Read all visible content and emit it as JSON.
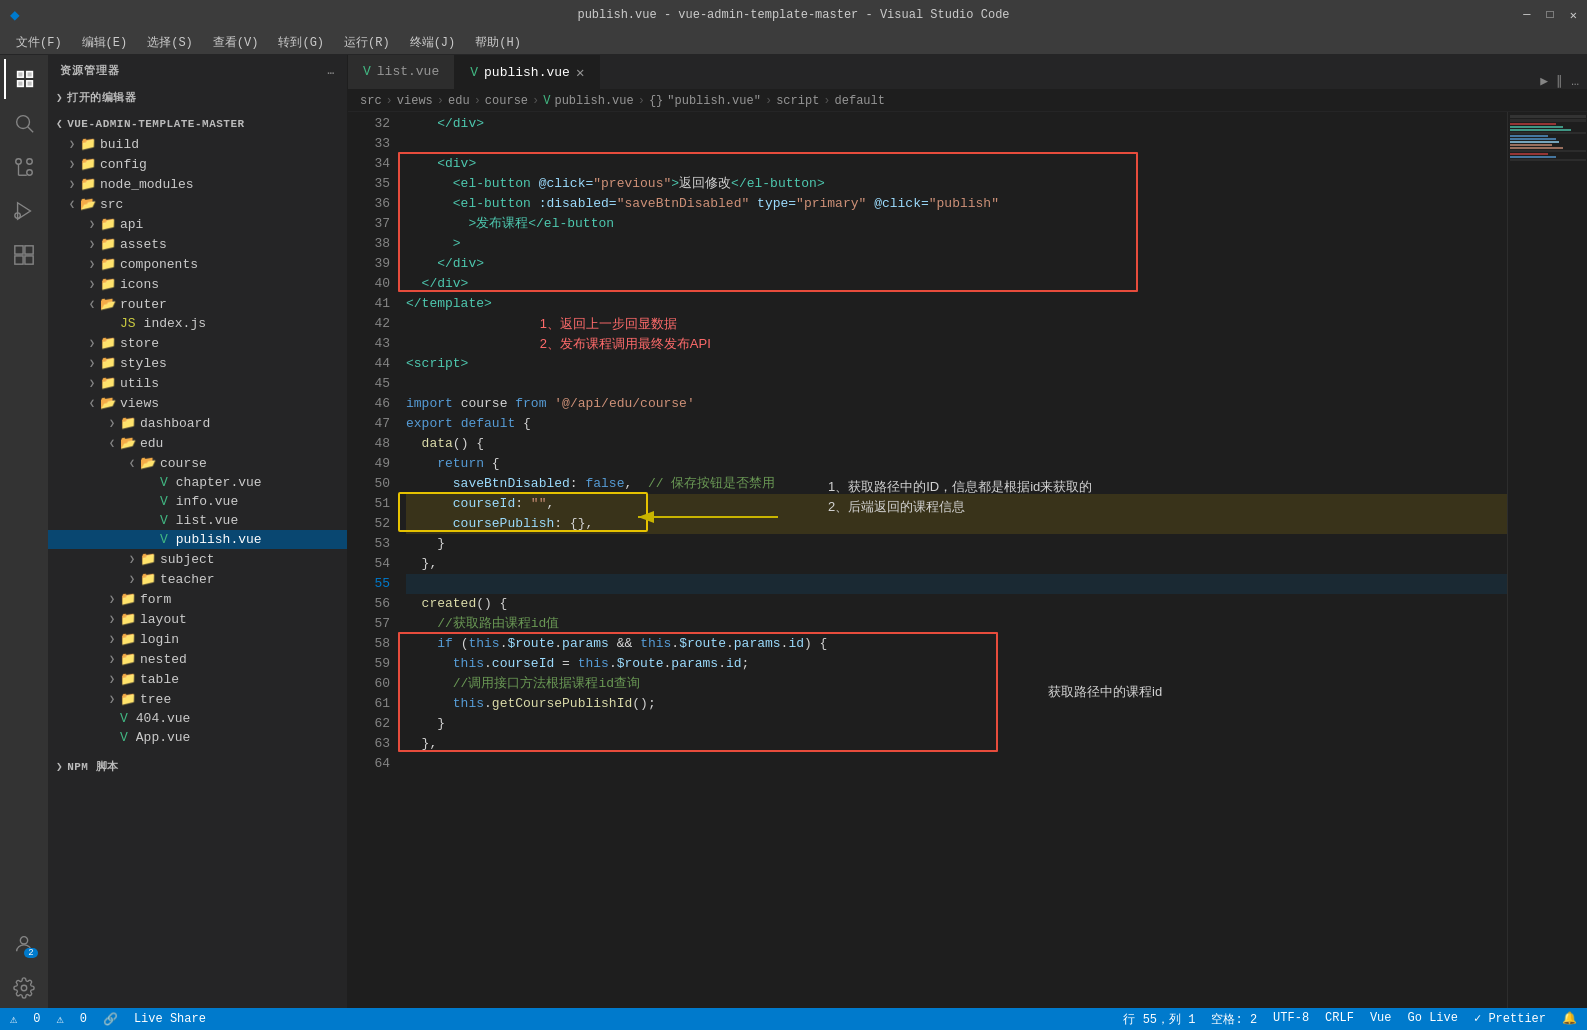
{
  "titleBar": {
    "title": "publish.vue - vue-admin-template-master - Visual Studio Code",
    "menuItems": [
      "文件(F)",
      "编辑(E)",
      "选择(S)",
      "查看(V)",
      "转到(G)",
      "运行(R)",
      "终端(J)",
      "帮助(H)"
    ]
  },
  "tabs": [
    {
      "id": "list",
      "label": "list.vue",
      "active": false,
      "icon": "vue"
    },
    {
      "id": "publish",
      "label": "publish.vue",
      "active": true,
      "icon": "vue"
    }
  ],
  "breadcrumb": [
    "src",
    ">",
    "views",
    ">",
    "edu",
    ">",
    "course",
    ">",
    "publish.vue",
    ">",
    "{}",
    "\"publish.vue\"",
    ">",
    "script",
    ">",
    "default"
  ],
  "sidebar": {
    "title": "资源管理器",
    "openEditors": "打开的编辑器",
    "projectName": "VUE-ADMIN-TEMPLATE-MASTER",
    "tree": [
      {
        "indent": 1,
        "type": "folder",
        "name": "build",
        "expanded": false
      },
      {
        "indent": 1,
        "type": "folder",
        "name": "config",
        "expanded": false
      },
      {
        "indent": 1,
        "type": "folder",
        "name": "node_modules",
        "expanded": false
      },
      {
        "indent": 1,
        "type": "folder",
        "name": "src",
        "expanded": true,
        "color": "src"
      },
      {
        "indent": 2,
        "type": "folder",
        "name": "api",
        "expanded": false
      },
      {
        "indent": 2,
        "type": "folder",
        "name": "assets",
        "expanded": false
      },
      {
        "indent": 2,
        "type": "folder",
        "name": "components",
        "expanded": false
      },
      {
        "indent": 2,
        "type": "folder",
        "name": "icons",
        "expanded": false
      },
      {
        "indent": 2,
        "type": "folder",
        "name": "router",
        "expanded": false,
        "active": false
      },
      {
        "indent": 3,
        "type": "file-js",
        "name": "index.js"
      },
      {
        "indent": 2,
        "type": "folder",
        "name": "store",
        "expanded": false
      },
      {
        "indent": 2,
        "type": "folder",
        "name": "styles",
        "expanded": false
      },
      {
        "indent": 2,
        "type": "folder",
        "name": "utils",
        "expanded": false
      },
      {
        "indent": 2,
        "type": "folder",
        "name": "views",
        "expanded": true
      },
      {
        "indent": 3,
        "type": "folder",
        "name": "dashboard",
        "expanded": false
      },
      {
        "indent": 3,
        "type": "folder",
        "name": "edu",
        "expanded": true
      },
      {
        "indent": 4,
        "type": "folder",
        "name": "course",
        "expanded": true
      },
      {
        "indent": 5,
        "type": "file-vue",
        "name": "chapter.vue"
      },
      {
        "indent": 5,
        "type": "file-vue",
        "name": "info.vue"
      },
      {
        "indent": 5,
        "type": "file-vue",
        "name": "list.vue"
      },
      {
        "indent": 5,
        "type": "file-vue",
        "name": "publish.vue",
        "active": true
      },
      {
        "indent": 4,
        "type": "folder",
        "name": "subject",
        "expanded": false
      },
      {
        "indent": 4,
        "type": "folder",
        "name": "teacher",
        "expanded": false
      },
      {
        "indent": 3,
        "type": "folder",
        "name": "form",
        "expanded": false
      },
      {
        "indent": 3,
        "type": "folder",
        "name": "layout",
        "expanded": false
      },
      {
        "indent": 3,
        "type": "folder",
        "name": "login",
        "expanded": false
      },
      {
        "indent": 3,
        "type": "folder",
        "name": "nested",
        "expanded": false
      },
      {
        "indent": 3,
        "type": "folder",
        "name": "table",
        "expanded": false
      },
      {
        "indent": 3,
        "type": "folder",
        "name": "tree",
        "expanded": false
      },
      {
        "indent": 3,
        "type": "file-vue",
        "name": "404.vue"
      },
      {
        "indent": 3,
        "type": "file-vue",
        "name": "App.vue"
      }
    ]
  },
  "codeLines": [
    {
      "num": 32,
      "content": "    </div>"
    },
    {
      "num": 33,
      "content": ""
    },
    {
      "num": 34,
      "content": "    <div>"
    },
    {
      "num": 35,
      "content": "      <el-button @click=\"previous\">返回修改</el-button>"
    },
    {
      "num": 36,
      "content": "      <el-button :disabled=\"saveBtnDisabled\" type=\"primary\" @click=\"publish\""
    },
    {
      "num": 37,
      "content": "        >发布课程</el-button>"
    },
    {
      "num": 38,
      "content": "      >"
    },
    {
      "num": 39,
      "content": "    </div>"
    },
    {
      "num": 40,
      "content": "  </div>"
    },
    {
      "num": 41,
      "content": "</template>"
    },
    {
      "num": 42,
      "content": ""
    },
    {
      "num": 43,
      "content": ""
    },
    {
      "num": 44,
      "content": "<script>"
    },
    {
      "num": 45,
      "content": ""
    },
    {
      "num": 46,
      "content": "import course from '@/api/edu/course'"
    },
    {
      "num": 47,
      "content": "export default {"
    },
    {
      "num": 48,
      "content": "  data() {"
    },
    {
      "num": 49,
      "content": "    return {"
    },
    {
      "num": 50,
      "content": "      saveBtnDisabled: false,  // 保存按钮是否禁用"
    },
    {
      "num": 51,
      "content": "      courseId: \"\","
    },
    {
      "num": 52,
      "content": "      coursePublish: {},"
    },
    {
      "num": 53,
      "content": "    }"
    },
    {
      "num": 54,
      "content": "  },"
    },
    {
      "num": 55,
      "content": ""
    },
    {
      "num": 56,
      "content": "  created() {"
    },
    {
      "num": 57,
      "content": "    //获取路由课程id值"
    },
    {
      "num": 58,
      "content": "    if (this.$route.params && this.$route.params.id) {"
    },
    {
      "num": 59,
      "content": "      this.courseId = this.$route.params.id;"
    },
    {
      "num": 60,
      "content": "      //调用接口方法根据课程id查询"
    },
    {
      "num": 61,
      "content": "      this.getCoursePublishId();"
    },
    {
      "num": 62,
      "content": "    }"
    },
    {
      "num": 63,
      "content": "  },"
    },
    {
      "num": 64,
      "content": ""
    }
  ],
  "annotations": {
    "redBox1": {
      "text1": "1、返回上一步回显数据",
      "text2": "2、发布课程调用最终发布API"
    },
    "yellowBox": {
      "text1": "1、获取路径中的ID，信息都是根据id来获取的",
      "text2": "2、后端返回的课程信息"
    },
    "arrowLabel": "获取路径中的课程id",
    "createdBox": {
      "label": "获取路径中的课程id"
    }
  },
  "statusBar": {
    "errors": "0",
    "warnings": "0",
    "liveShare": "Live Share",
    "row": "行 55，列 1",
    "spaces": "空格: 2",
    "encoding": "UTF-8",
    "lineEnding": "CRLF",
    "language": "Vue",
    "goLive": "Go Live",
    "prettier": "✓ Prettier"
  }
}
